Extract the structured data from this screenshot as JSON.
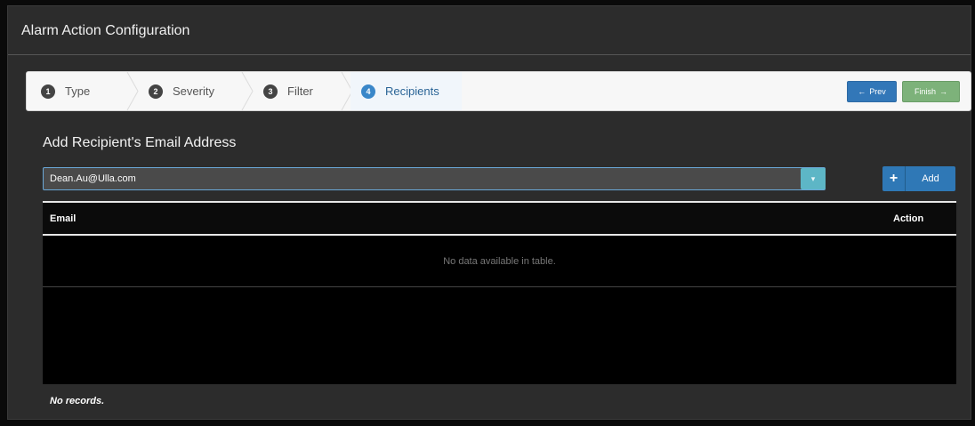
{
  "modal": {
    "title": "Alarm Action Configuration",
    "close_glyph": "×"
  },
  "wizard": {
    "steps": [
      {
        "num": "1",
        "label": "Type"
      },
      {
        "num": "2",
        "label": "Severity"
      },
      {
        "num": "3",
        "label": "Filter"
      },
      {
        "num": "4",
        "label": "Recipients"
      }
    ],
    "active_step": 4,
    "prev_label": "Prev",
    "prev_icon": "←",
    "finish_label": "Finish",
    "finish_icon": "→"
  },
  "recipients": {
    "section_title": "Add Recipient's Email Address",
    "selected_email": "Dean.Au@Ulla.com",
    "dropdown_glyph": "▾",
    "add_icon": "+",
    "add_label": "Add"
  },
  "table": {
    "columns": [
      "Email",
      "Action"
    ],
    "empty_message": "No data available in table."
  },
  "footer": {
    "records_text": "No records."
  },
  "colors": {
    "primary": "#2f78b6",
    "success": "#7db27a",
    "info": "#5db6c6"
  }
}
